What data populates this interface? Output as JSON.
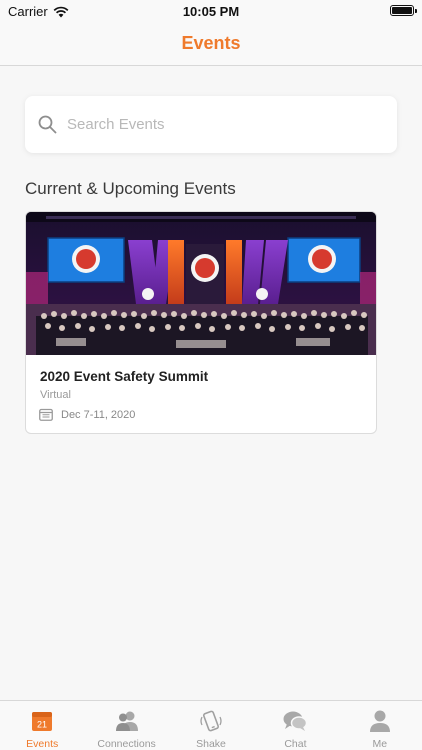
{
  "status_bar": {
    "carrier": "Carrier",
    "time": "10:05 PM"
  },
  "nav": {
    "title": "Events"
  },
  "search": {
    "placeholder": "Search Events",
    "value": ""
  },
  "section": {
    "title": "Current & Upcoming Events"
  },
  "events": [
    {
      "title": "2020 Event Safety Summit",
      "location": "Virtual",
      "date": "Dec 7-11, 2020"
    }
  ],
  "tabs": [
    {
      "label": "Events",
      "icon": "calendar-icon",
      "badge": "21",
      "active": true
    },
    {
      "label": "Connections",
      "icon": "people-icon",
      "active": false
    },
    {
      "label": "Shake",
      "icon": "shake-phone-icon",
      "active": false
    },
    {
      "label": "Chat",
      "icon": "chat-icon",
      "active": false
    },
    {
      "label": "Me",
      "icon": "person-icon",
      "active": false
    }
  ],
  "colors": {
    "accent": "#ef7a2c",
    "inactive": "#9a9a9a"
  }
}
